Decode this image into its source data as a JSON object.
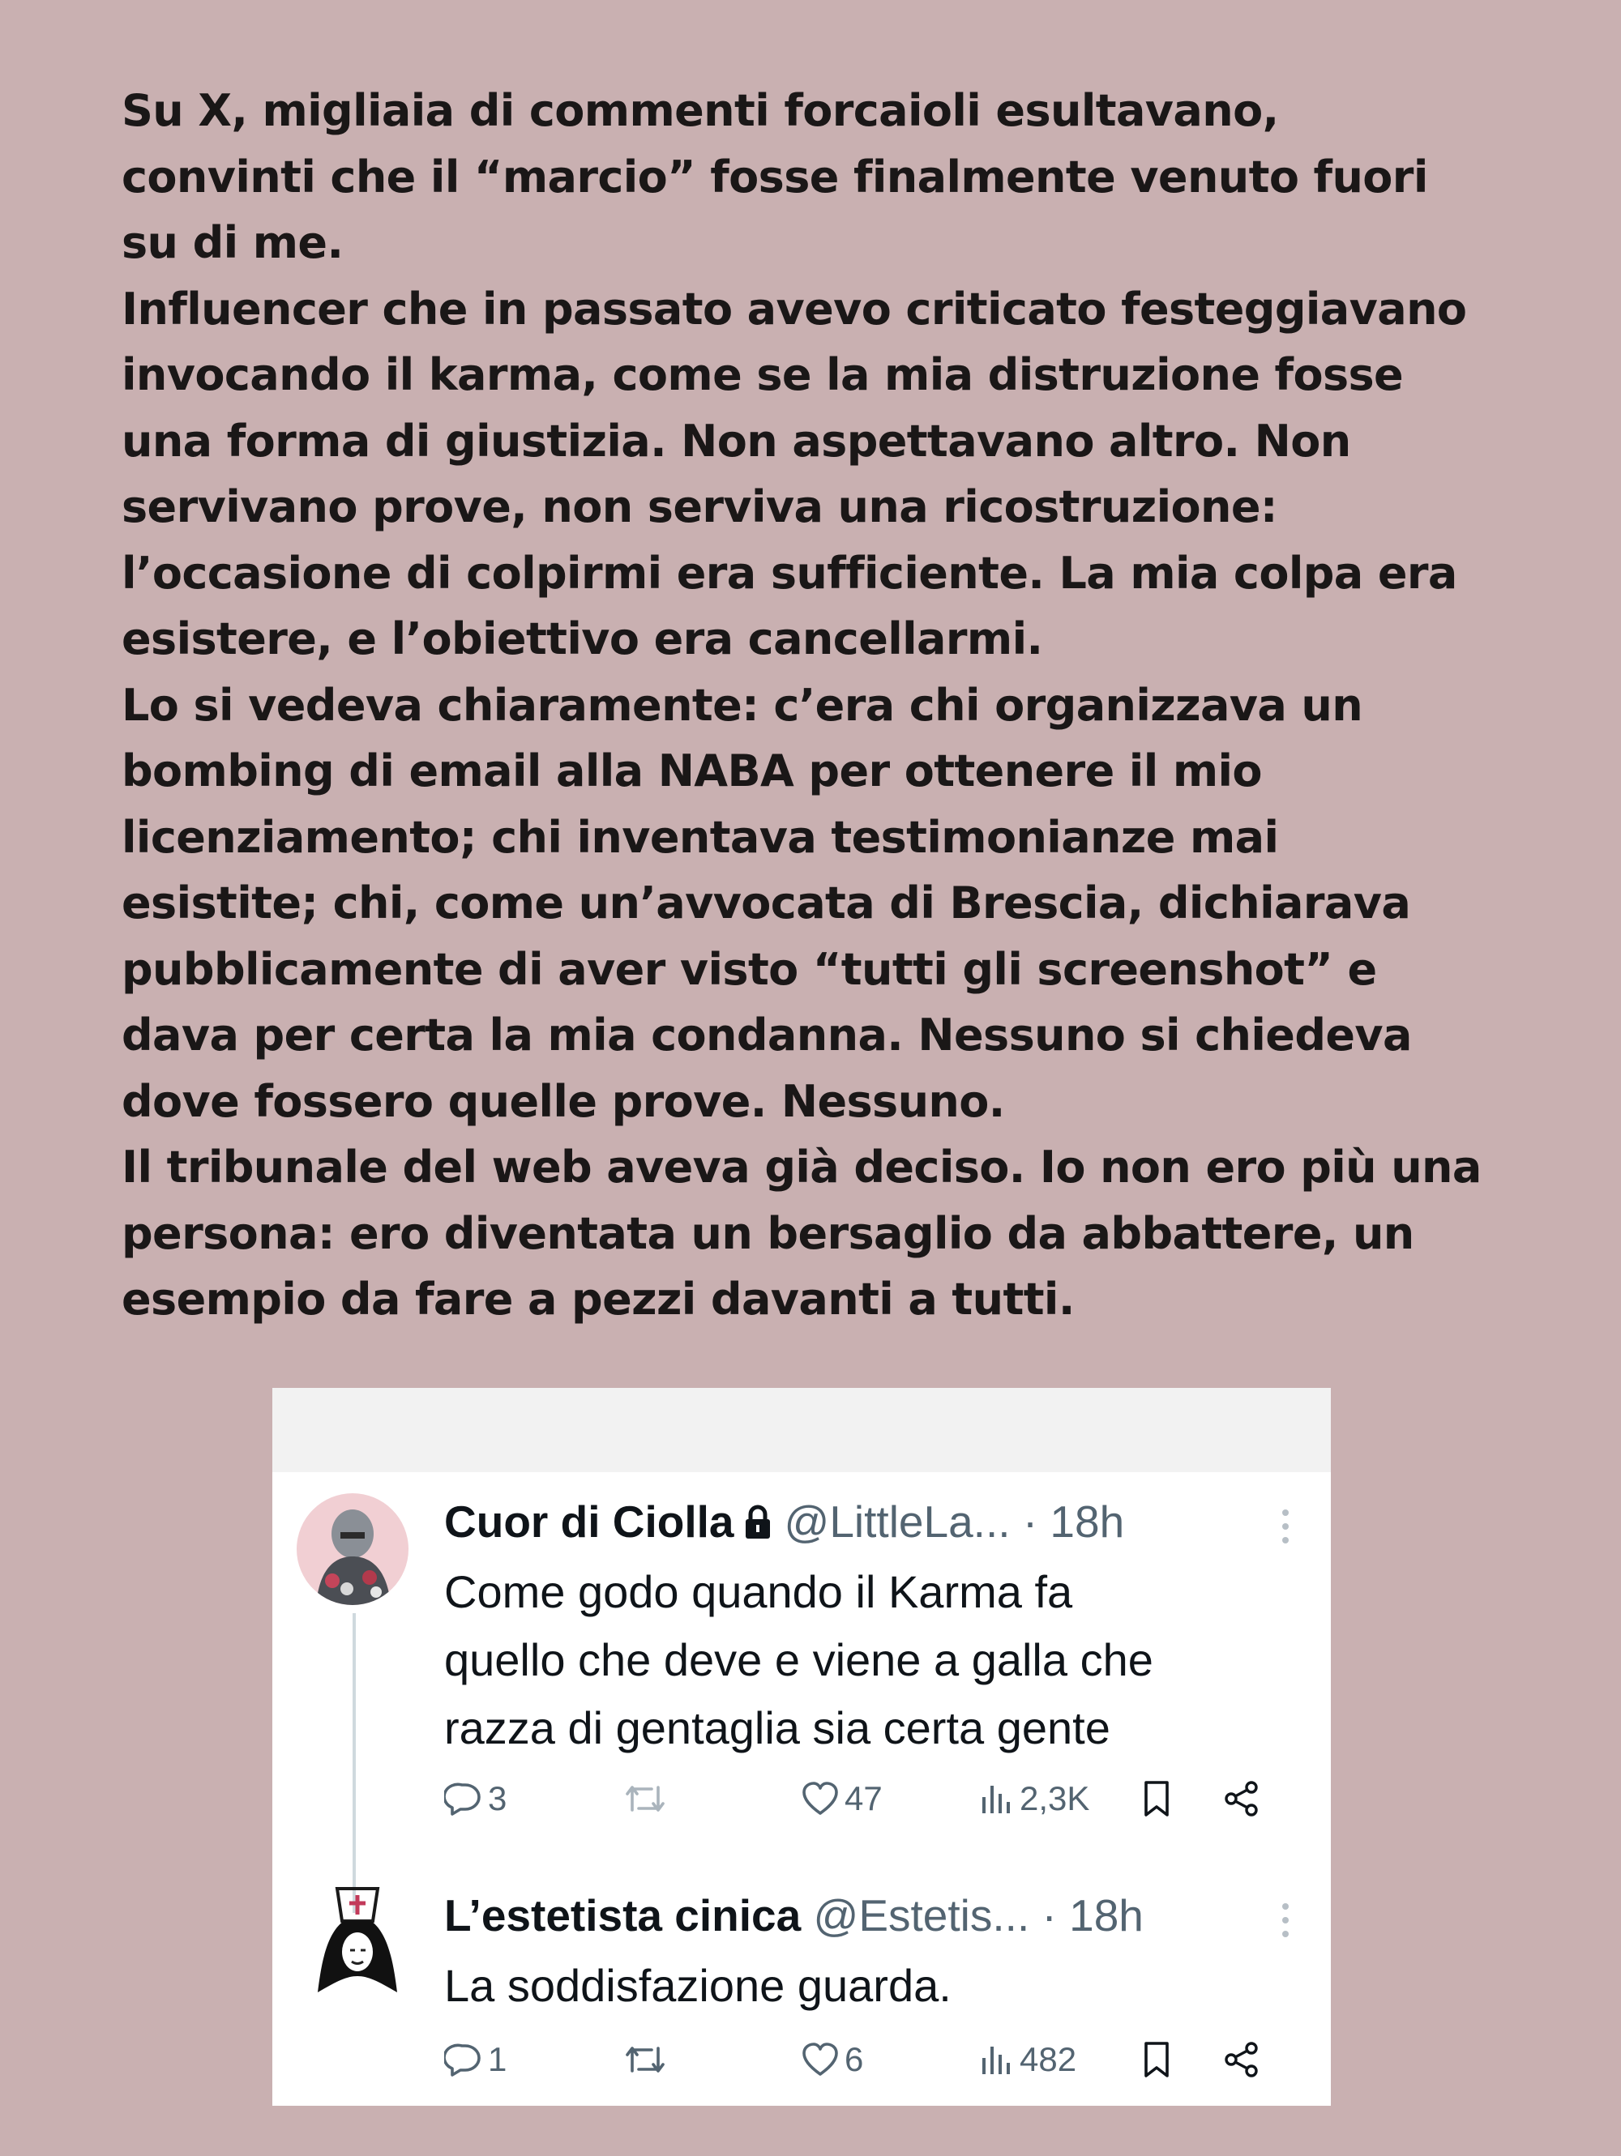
{
  "essay": {
    "paragraphs": [
      "Su X, migliaia di commenti forcaioli esultavano,\nconvinti che il “marcio” fosse finalmente venuto fuori\nsu di me.",
      "Influencer che in passato avevo criticato festeggiavano\ninvocando il karma, come se la mia distruzione fosse\nuna forma di giustizia. Non aspettavano altro. Non\nservivano prove, non serviva una ricostruzione:\nl’occasione di colpirmi era sufficiente. La mia colpa era\nesistere, e l’obiettivo era cancellarmi.",
      "Lo si vedeva chiaramente: c’era chi organizzava un\nbombing di email alla NABA per ottenere il mio\nlicenziamento; chi inventava testimonianze mai\nesistite; chi, come un’avvocata di Brescia, dichiarava\npubblicamente di aver visto “tutti gli screenshot” e\ndava per certa la mia condanna. Nessuno si chiedeva\ndove fossero quelle prove. Nessuno.",
      "Il tribunale del web aveva già deciso. Io non ero più una\npersona: ero diventata un bersaglio da abbattere, un\nesempio da fare a pezzi davanti a tutti."
    ]
  },
  "tweets": [
    {
      "name": "Cuor di Ciolla",
      "locked": true,
      "handle": "@LittleLa...",
      "separator": "·",
      "time": "18h",
      "text": "Come godo quando il Karma fa\nquello che deve e viene a galla che\nrazza di gentaglia sia certa gente",
      "replies": "3",
      "retweets": "",
      "likes": "47",
      "views": "2,3K"
    },
    {
      "name": "L’estetista cinica",
      "locked": false,
      "handle": "@Estetis...",
      "separator": "·",
      "time": "18h",
      "text": "La soddisfazione guarda.",
      "replies": "1",
      "retweets": "",
      "likes": "6",
      "views": "482"
    }
  ],
  "colors": {
    "background": "#c9b0b1",
    "essay_text": "#1a1717",
    "tweet_text": "#0f1419",
    "tweet_muted": "#536471",
    "thread_line": "#cfd9de"
  },
  "icons": {
    "reply": "speech-bubble-icon",
    "retweet": "retweet-icon",
    "like": "heart-icon",
    "views": "bar-chart-icon",
    "bookmark": "bookmark-icon",
    "share": "share-icon",
    "lock": "lock-icon",
    "more": "more-dots-icon"
  }
}
